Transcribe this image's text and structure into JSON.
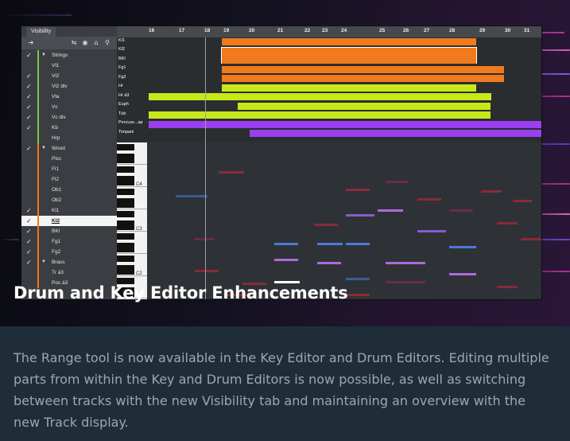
{
  "colors": {
    "orange": "#f07a1c",
    "lime": "#c9e81a",
    "purple": "#9a3ff0",
    "caption_bg": "#1f2d38",
    "description_text": "#9aa8b2"
  },
  "visibility_panel": {
    "tab_label": "Visibility",
    "toolbar_icons": [
      "arrow-icon",
      "filter-icon",
      "eye-icon",
      "home-icon",
      "search-icon"
    ],
    "rows": [
      {
        "label": "Strings",
        "checked": true,
        "folder": true,
        "color": "#7ac943"
      },
      {
        "label": "Vl1",
        "checked": false,
        "color": "#7ac943"
      },
      {
        "label": "Vl2",
        "checked": true,
        "color": "#7ac943"
      },
      {
        "label": "Vl2 div",
        "checked": true,
        "color": "#7ac943"
      },
      {
        "label": "Vla",
        "checked": true,
        "color": "#7ac943"
      },
      {
        "label": "Vc",
        "checked": true,
        "color": "#7ac943"
      },
      {
        "label": "Vc div",
        "checked": true,
        "color": "#7ac943"
      },
      {
        "label": "Kb",
        "checked": true,
        "color": "#7ac943"
      },
      {
        "label": "Hrp",
        "checked": false,
        "color": "#7ac943"
      },
      {
        "label": "Wood",
        "checked": true,
        "folder": true,
        "color": "#f07a1c"
      },
      {
        "label": "Picc",
        "checked": false,
        "color": "#f07a1c"
      },
      {
        "label": "Fl1",
        "checked": false,
        "color": "#f07a1c"
      },
      {
        "label": "Fl2",
        "checked": false,
        "color": "#f07a1c"
      },
      {
        "label": "Ob1",
        "checked": false,
        "color": "#f07a1c"
      },
      {
        "label": "Ob2",
        "checked": false,
        "color": "#f07a1c"
      },
      {
        "label": "Kl1",
        "checked": true,
        "color": "#f07a1c"
      },
      {
        "label": "Kl2",
        "checked": true,
        "color": "#f07a1c",
        "selected": true
      },
      {
        "label": "BKl",
        "checked": true,
        "color": "#f07a1c"
      },
      {
        "label": "Fg1",
        "checked": true,
        "color": "#f07a1c"
      },
      {
        "label": "Fg2",
        "checked": true,
        "color": "#f07a1c"
      },
      {
        "label": "Brass",
        "checked": true,
        "folder": true,
        "color": "#f07a1c"
      },
      {
        "label": "Tr á3",
        "checked": false,
        "color": "#f07a1c"
      },
      {
        "label": "Pos á3",
        "checked": false,
        "color": "#f07a1c"
      }
    ]
  },
  "ruler": [
    "16",
    "17",
    "18",
    "19",
    "20",
    "21",
    "22",
    "23",
    "24",
    "25",
    "26",
    "27",
    "28",
    "29",
    "30",
    "31"
  ],
  "track_names": [
    "Kl1",
    "Kl2",
    "BKl",
    "Fg1",
    "Fg2",
    "Hr",
    "Hr á3",
    "Euph",
    "Tub",
    "Percuss...ap",
    "Timpani"
  ],
  "piano_labels": [
    "C4",
    "C3",
    "C2"
  ],
  "caption": {
    "title": "Drum and Key Editor Enhancements",
    "description": "The Range tool is now available in the Key Editor and Drum Editors. Editing multiple parts from within the Key and Drum Editors is now possible, as well as switching between tracks with the new Visibility tab and maintaining an overview with the new Track display."
  }
}
